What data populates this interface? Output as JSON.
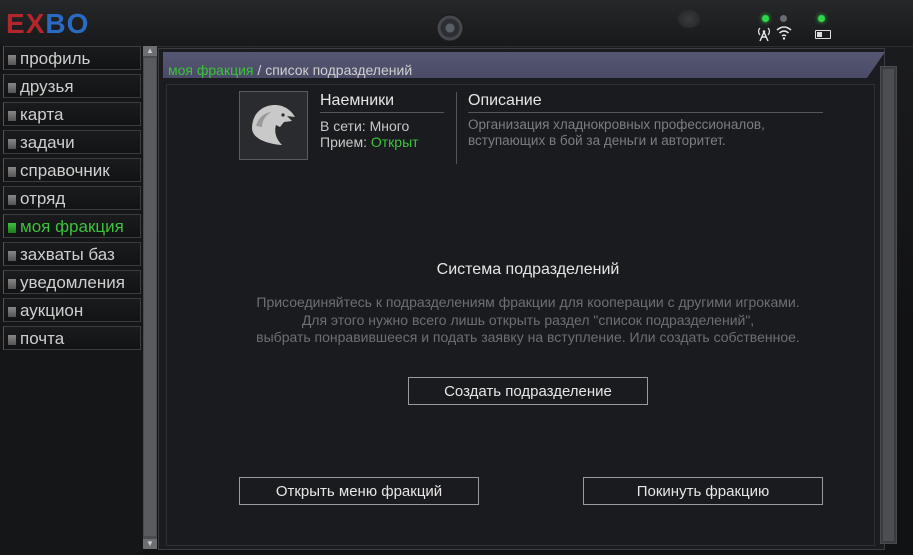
{
  "app": {
    "logo_e": "E",
    "logo_x": "X",
    "logo_bo": "BO"
  },
  "system_icons": [
    "antenna-icon",
    "wifi-icon",
    "battery-icon"
  ],
  "colors": {
    "accent_green": "#3cc23c",
    "logo_red": "#b3262b",
    "logo_blue": "#2a6bc2",
    "header_strip": "#565772"
  },
  "sidebar": {
    "items": [
      {
        "label": "профиль",
        "active": false
      },
      {
        "label": "друзья",
        "active": false
      },
      {
        "label": "карта",
        "active": false
      },
      {
        "label": "задачи",
        "active": false
      },
      {
        "label": "справочник",
        "active": false
      },
      {
        "label": "отряд",
        "active": false
      },
      {
        "label": "моя фракция",
        "active": true
      },
      {
        "label": "захваты баз",
        "active": false
      },
      {
        "label": "уведомления",
        "active": false
      },
      {
        "label": "аукцион",
        "active": false
      },
      {
        "label": "почта",
        "active": false
      }
    ]
  },
  "breadcrumb": {
    "link": "моя фракция",
    "separator": " / ",
    "current": "список подразделений"
  },
  "faction": {
    "name": "Наемники",
    "online_label": "В сети: ",
    "online_value": "Много",
    "recruit_label": "Прием: ",
    "recruit_value": "Открыт",
    "description_title": "Описание",
    "description_line1": "Организация хладнокровных профессионалов,",
    "description_line2": "вступающих в бой за деньги и авторитет."
  },
  "divisions": {
    "title": "Система подразделений",
    "line1": "Присоединяйтесь к подразделениям фракции для кооперации с другими игроками.",
    "line2": "Для этого нужно всего лишь открыть раздел \"список подразделений\",",
    "line3": "выбрать понравившееся и подать заявку на вступление. Или создать собственное.",
    "create_button": "Создать подразделение"
  },
  "actions": {
    "open_menu_button": "Открыть меню фракций",
    "leave_button": "Покинуть фракцию"
  }
}
